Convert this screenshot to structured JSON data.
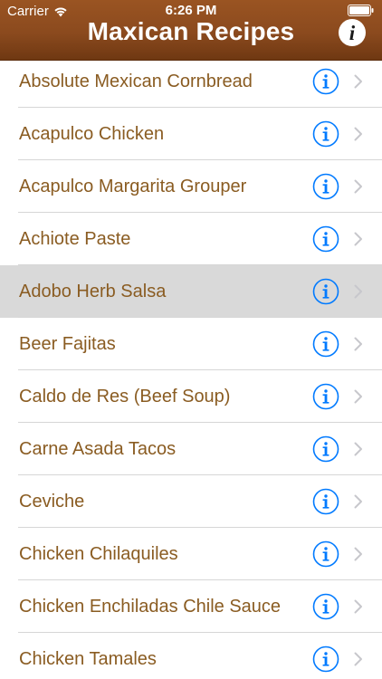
{
  "status_bar": {
    "carrier": "Carrier",
    "time": "6:26 PM"
  },
  "header": {
    "title": "Maxican Recipes",
    "info_button_glyph": "i"
  },
  "colors": {
    "header_brown": "#8b4a1e",
    "recipe_text": "#8a5c22",
    "info_blue": "#007aff",
    "selected_row": "#d9d9d9"
  },
  "icons": {
    "row_detail": "info-circle-icon",
    "row_disclosure": "chevron-right-icon",
    "nav_info": "info-icon"
  },
  "recipes": [
    {
      "label": "Absolute Mexican Cornbread"
    },
    {
      "label": "Acapulco Chicken"
    },
    {
      "label": "Acapulco Margarita Grouper"
    },
    {
      "label": "Achiote Paste"
    },
    {
      "label": "Adobo Herb Salsa",
      "selected": true
    },
    {
      "label": "Beer Fajitas"
    },
    {
      "label": "Caldo de Res (Beef Soup)"
    },
    {
      "label": "Carne Asada Tacos"
    },
    {
      "label": "Ceviche"
    },
    {
      "label": "Chicken Chilaquiles"
    },
    {
      "label": "Chicken Enchiladas Chile Sauce"
    },
    {
      "label": "Chicken Tamales"
    }
  ]
}
